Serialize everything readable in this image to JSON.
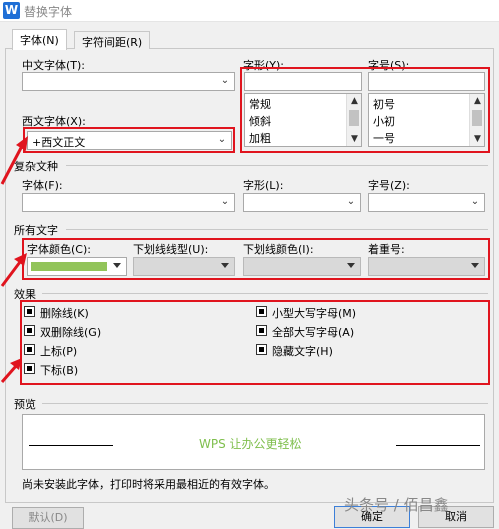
{
  "window": {
    "title": "替换字体",
    "app_icon": "W"
  },
  "tabs": [
    {
      "label": "字体(N)",
      "active": true
    },
    {
      "label": "字符间距(R)",
      "active": false
    }
  ],
  "chinese": {
    "font_label": "中文字体(T):",
    "font_value": "",
    "style_label": "字形(Y):",
    "style_value": "",
    "style_list": [
      "常规",
      "倾斜",
      "加粗"
    ],
    "size_label": "字号(S):",
    "size_value": "",
    "size_list": [
      "初号",
      "小初",
      "一号"
    ]
  },
  "western": {
    "font_label": "西文字体(X):",
    "font_value": "+西文正文"
  },
  "complex": {
    "section": "复杂文种",
    "font_label": "字体(F):",
    "style_label": "字形(L):",
    "size_label": "字号(Z):"
  },
  "all_text": {
    "section": "所有文字",
    "color_label": "字体颜色(C):",
    "color_value": "#92c45a",
    "underline_label": "下划线线型(U):",
    "underline_color_label": "下划线颜色(I):",
    "emphasis_label": "着重号:"
  },
  "effects": {
    "section": "效果",
    "left": [
      {
        "label": "删除线(K)",
        "checked": true
      },
      {
        "label": "双删除线(G)",
        "checked": true
      },
      {
        "label": "上标(P)",
        "checked": true
      },
      {
        "label": "下标(B)",
        "checked": true
      }
    ],
    "right": [
      {
        "label": "小型大写字母(M)",
        "checked": true
      },
      {
        "label": "全部大写字母(A)",
        "checked": true
      },
      {
        "label": "隐藏文字(H)",
        "checked": true
      }
    ]
  },
  "preview": {
    "section": "预览",
    "sample": "WPS 让办公更轻松"
  },
  "note": "尚未安装此字体，打印时将采用最相近的有效字体。",
  "buttons": {
    "default": "默认(D)",
    "ok": "确定",
    "cancel": "取消"
  },
  "watermark": "头条号 / 佰昌鑫",
  "colors": {
    "highlight": "#e0141e",
    "preview_text": "#7fbf4d"
  }
}
